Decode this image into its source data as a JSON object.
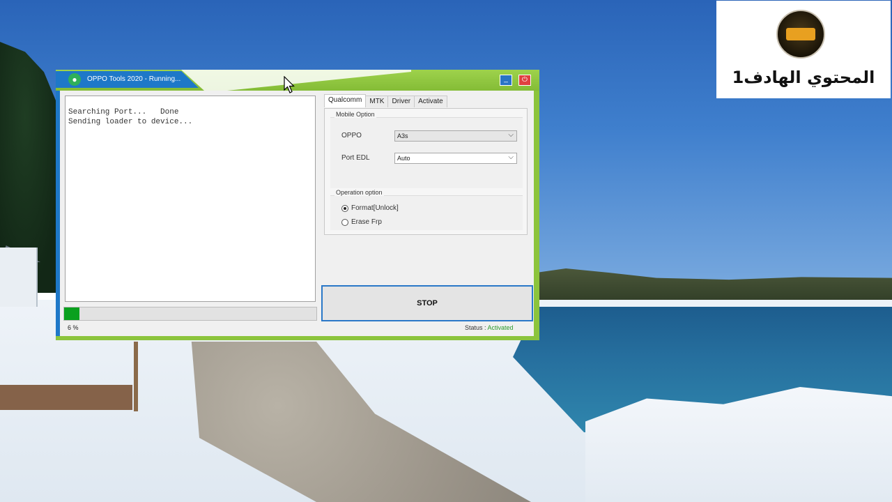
{
  "background": {
    "description_icons": [
      "snow-beach-scene"
    ]
  },
  "logo": {
    "text": "المحتوي الهادف1",
    "badge_icon": "channel-logo-icon"
  },
  "window": {
    "title": "OPPO Tools 2020 - Running...",
    "app_icon": "android-icon",
    "minimize_icon": "minimize-icon",
    "close_icon": "close-icon"
  },
  "log": {
    "lines": [
      "Searching Port...   Done",
      "Sending loader to device..."
    ]
  },
  "progress": {
    "value_percent": 6,
    "label": "6 %"
  },
  "tabs": [
    {
      "label": "Qualcomm",
      "active": true
    },
    {
      "label": "MTK",
      "active": false
    },
    {
      "label": "Driver",
      "active": false
    },
    {
      "label": "Activate",
      "active": false
    }
  ],
  "mobile_option": {
    "title": "Mobile Option",
    "oppo_label": "OPPO",
    "oppo_value": "A3s",
    "port_label": "Port EDL",
    "port_value": "Auto"
  },
  "operation_option": {
    "title": "Operation option",
    "options": [
      {
        "label": "Format[Unlock]",
        "selected": true
      },
      {
        "label": "Erase Frp",
        "selected": false
      }
    ]
  },
  "stop_button": {
    "label": "STOP"
  },
  "status": {
    "label": "Status :",
    "value": "Activated"
  },
  "colors": {
    "window_frame": "#8cc43c",
    "title_blue": "#1e78c8",
    "progress_fill": "#0aa01e",
    "status_ok": "#2a9a2a"
  }
}
